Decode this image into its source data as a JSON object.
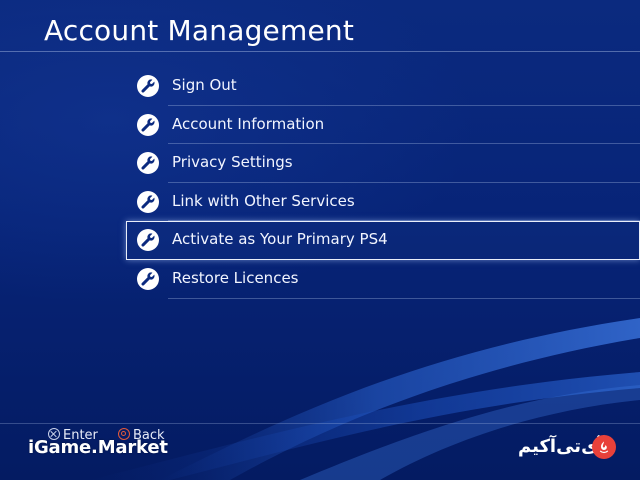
{
  "header": {
    "title": "Account Management"
  },
  "menu": {
    "items": [
      {
        "label": "Sign Out",
        "icon": "wrench-icon"
      },
      {
        "label": "Account Information",
        "icon": "wrench-icon"
      },
      {
        "label": "Privacy Settings",
        "icon": "wrench-icon"
      },
      {
        "label": "Link with Other Services",
        "icon": "wrench-icon"
      },
      {
        "label": "Activate as Your Primary PS4",
        "icon": "wrench-icon",
        "selected": true
      },
      {
        "label": "Restore Licences",
        "icon": "wrench-icon"
      }
    ]
  },
  "footer": {
    "enter_label": "Enter",
    "enter_icon": "cross-button-icon",
    "back_label": "Back",
    "back_icon": "circle-button-icon"
  },
  "watermarks": {
    "left": "iGame.Market",
    "right": "آی‌تی‌آکیم",
    "right_logo_color": "#e8413a"
  },
  "colors": {
    "background": "#072478",
    "text": "#ffffff",
    "selection_border": "#e9eef9",
    "back_button_accent": "#e45a3a"
  }
}
